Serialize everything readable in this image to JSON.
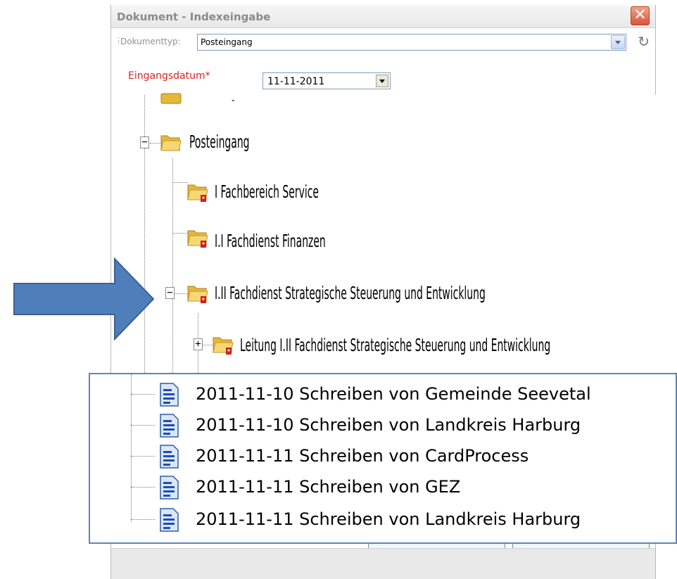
{
  "dialog": {
    "title": "Dokument - Indexeingabe",
    "close_symbol": "✕",
    "doctype_label": "Dokumenttyp:",
    "doctype_value": "Posteingang",
    "date_label": "Eingangsdatum*",
    "date_value": "11-11-2011"
  },
  "tree": {
    "items": [
      {
        "label": "Posteingang",
        "expander": "−",
        "icon": "folder-open-icon"
      },
      {
        "label": "I Fachbereich Service",
        "icon": "folder-locked-icon"
      },
      {
        "label": "I.I Fachdienst Finanzen",
        "icon": "folder-locked-icon"
      },
      {
        "label": "I.II Fachdienst Strategische Steuerung und Entwicklung",
        "expander": "−",
        "icon": "folder-locked-icon"
      },
      {
        "label": "Leitung I.II Fachdienst Strategische Steuerung und Entwicklung",
        "expander": "+",
        "icon": "folder-locked-icon"
      }
    ]
  },
  "documents": [
    {
      "label": "2011-11-10 Schreiben von Gemeinde Seevetal",
      "icon": "document-icon"
    },
    {
      "label": "2011-11-10 Schreiben von Landkreis Harburg",
      "icon": "document-icon"
    },
    {
      "label": "2011-11-11 Schreiben von CardProcess",
      "icon": "document-icon"
    },
    {
      "label": "2011-11-11 Schreiben von GEZ",
      "icon": "document-icon"
    },
    {
      "label": "2011-11-11 Schreiben von Landkreis Harburg",
      "icon": "document-icon"
    }
  ],
  "colors": {
    "arrow_fill": "#4f7fba",
    "arrow_stroke": "#3a6192",
    "required_label": "#e02020",
    "panel_border": "#5b86b8"
  }
}
